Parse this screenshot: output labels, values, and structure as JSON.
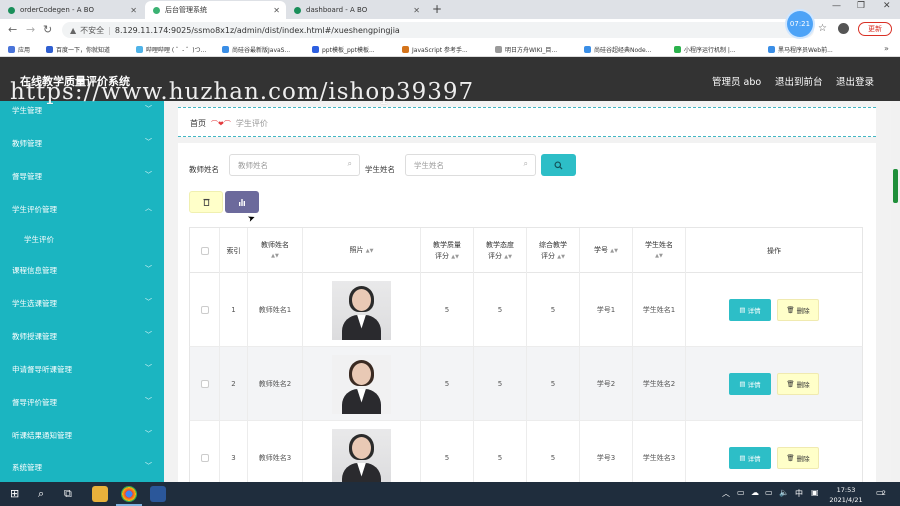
{
  "browser": {
    "tabs": [
      {
        "title": "orderCodegen - A BO",
        "icon_color": "#1a8f5a"
      },
      {
        "title": "后台管理系统",
        "icon_color": "#3bb273"
      },
      {
        "title": "dashboard - A BO",
        "icon_color": "#1a8f5a"
      }
    ],
    "url_insecure": "不安全",
    "url": "8.129.11.174:9025/ssmo8x1z/admin/dist/index.html#/xueshengpingjia",
    "timer": "07:21",
    "update_label": "更新",
    "bookmarks": [
      "应用",
      "百度一下，你就知道",
      "哔哩哔哩 ( ゜- ゜)つ...",
      "尚硅谷最新版JavaS...",
      "ppt模板_ppt模板...",
      "JavaScript 参考手...",
      "明日方舟WIKI_目...",
      "尚硅谷超经典Node...",
      "小程序运行机制 |...",
      "黑马程序员Web前..."
    ]
  },
  "header": {
    "title": "在线教学质量评价系统",
    "user": "管理员 abo",
    "to_frontend": "退出到前台",
    "logout": "退出登录"
  },
  "watermark": "https://www.huzhan.com/ishop39397",
  "sidebar": {
    "items": [
      {
        "label": "学生管理",
        "chevron": "﹀"
      },
      {
        "label": "教师管理",
        "chevron": "﹀"
      },
      {
        "label": "督导管理",
        "chevron": "﹀"
      },
      {
        "label": "学生评价管理",
        "chevron": "︿"
      },
      {
        "label": "课程信息管理",
        "chevron": "﹀"
      },
      {
        "label": "学生选课管理",
        "chevron": "﹀"
      },
      {
        "label": "教师授课管理",
        "chevron": "﹀"
      },
      {
        "label": "申请督导听课管理",
        "chevron": "﹀"
      },
      {
        "label": "督导评价管理",
        "chevron": "﹀"
      },
      {
        "label": "听课结果通知管理",
        "chevron": "﹀"
      },
      {
        "label": "系统管理",
        "chevron": "﹀"
      }
    ],
    "subitem": "学生评价"
  },
  "breadcrumb": {
    "home": "首页",
    "current": "学生评价"
  },
  "search": {
    "teacher_label": "教师姓名",
    "teacher_placeholder": "教师姓名",
    "student_label": "学生姓名",
    "student_placeholder": "学生姓名"
  },
  "table": {
    "headers": {
      "index": "索引",
      "teacher": "教师姓名",
      "photo": "照片",
      "quality_1": "教学质量",
      "quality_2": "评分",
      "attitude_1": "教学态度",
      "attitude_2": "评分",
      "overall_1": "综合教学",
      "overall_2": "评分",
      "student_no": "学号",
      "student_name": "学生姓名",
      "action": "操作"
    },
    "rows": [
      {
        "index": "1",
        "teacher": "教师姓名1",
        "quality": "5",
        "attitude": "5",
        "overall": "5",
        "student_no": "学号1",
        "student_name": "学生姓名1"
      },
      {
        "index": "2",
        "teacher": "教师姓名2",
        "quality": "5",
        "attitude": "5",
        "overall": "5",
        "student_no": "学号2",
        "student_name": "学生姓名2"
      },
      {
        "index": "3",
        "teacher": "教师姓名3",
        "quality": "5",
        "attitude": "5",
        "overall": "5",
        "student_no": "学号3",
        "student_name": "学生姓名3"
      }
    ],
    "detail_label": "详情",
    "delete_label": "删除"
  },
  "taskbar": {
    "time": "17:53",
    "date": "2021/4/21",
    "ime": "中",
    "notification_count": "2"
  }
}
